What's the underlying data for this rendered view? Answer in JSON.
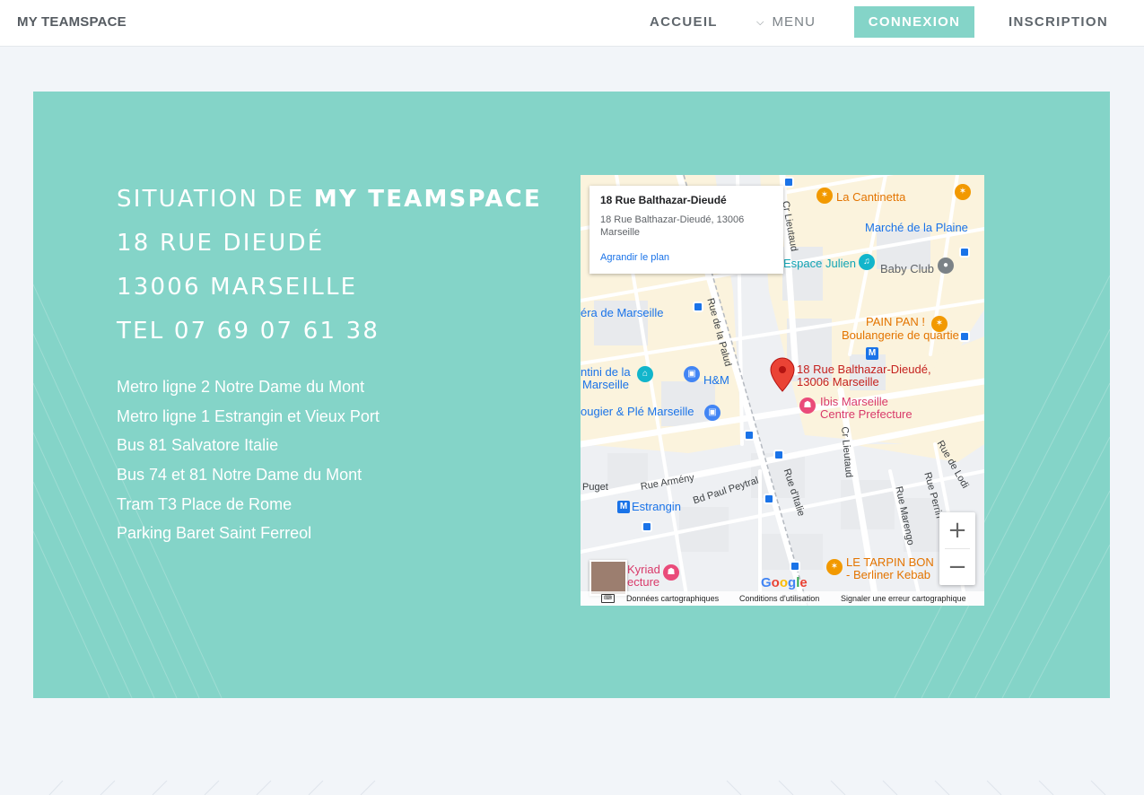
{
  "header": {
    "brand": "MY TEAMSPACE",
    "nav": {
      "accueil": "ACCUEIL",
      "menu": "MENU",
      "connexion": "CONNEXION",
      "inscription": "INSCRIPTION"
    }
  },
  "colors": {
    "accent": "#84d4c8",
    "page_background": "#f2f5f9",
    "nav_text": "#5f666c"
  },
  "location": {
    "heading_prefix": "SITUATION DE ",
    "heading_brand": "MY TEAMSPACE",
    "address_line": "18 RUE DIEUDÉ",
    "city_line": "13006 MARSEILLE",
    "phone_line": "TEL 07 69 07 61 38",
    "transport": [
      "Metro ligne 2 Notre Dame du Mont",
      "Metro ligne 1 Estrangin et Vieux Port",
      "Bus 81 Salvatore Italie",
      "Bus 74 et 81 Notre Dame du Mont",
      "Tram T3 Place de Rome",
      "Parking Baret Saint Ferreol"
    ]
  },
  "map": {
    "info_window": {
      "title": "18 Rue Balthazar-Dieudé",
      "address": "18 Rue Balthazar-Dieudé, 13006 Marseille",
      "link": "Agrandir le plan"
    },
    "marker_label": {
      "line1": "18 Rue Balthazar-Dieudé,",
      "line2": "13006 Marseille"
    },
    "places": {
      "la_cantinetta": "La Cantinetta",
      "marche_plaine": "Marché de la Plaine",
      "espace_julien": "Espace Julien",
      "baby_club": "Baby Club",
      "pain_pan_1": "PAIN PAN !",
      "pain_pan_2": "Boulangerie de quartier",
      "opera": "éra de Marseille",
      "hm": "H&M",
      "cantini_1": "ntini de la",
      "cantini_2": "Marseille",
      "ibis_1": "Ibis Marseille",
      "ibis_2": "Centre Prefecture",
      "rougier": "ougier & Plé Marseille",
      "estrangin": "Estrangin",
      "kyriad_1": "Kyriad",
      "kyriad_2": "ecture",
      "tarpin_1": "LE TARPIN BON",
      "tarpin_2": "- Berliner Kebab"
    },
    "streets": {
      "cr_lieutaud_top": "Cr Lieutaud",
      "cr_lieutaud": "Cr Lieutaud",
      "rue_palud": "Rue de la Palud",
      "rue_armeny": "Rue Armény",
      "bd_peytral": "Bd Paul Peytral",
      "rue_italie": "Rue d'Italie",
      "rue_marengo": "Rue Marengo",
      "rue_perrin": "Rue Perrin",
      "rue_lodi": "Rue de Lodi",
      "puget": "Puget"
    },
    "zoom_in": "+",
    "zoom_out": "−",
    "google": [
      "G",
      "o",
      "o",
      "g",
      "l",
      "e"
    ],
    "attribution": {
      "data": "Données cartographiques",
      "terms": "Conditions d'utilisation",
      "report": "Signaler une erreur cartographique"
    }
  }
}
